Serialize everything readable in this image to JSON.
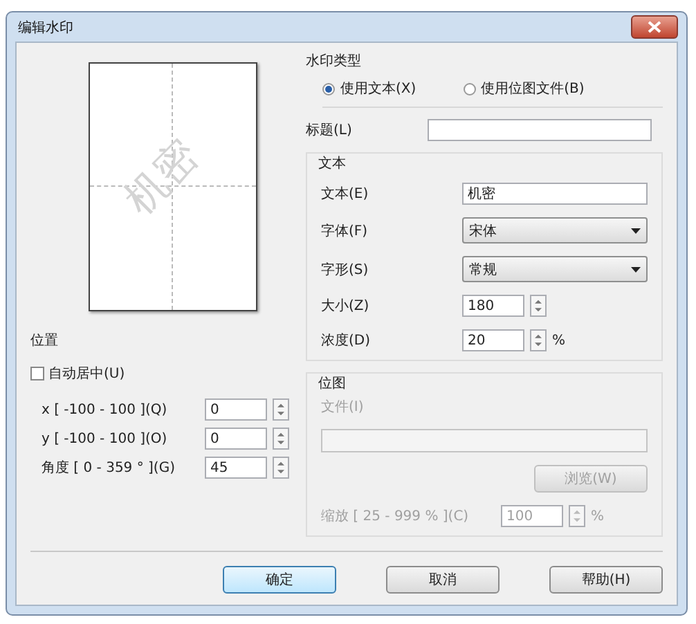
{
  "window": {
    "title": "编辑水印"
  },
  "preview": {
    "text": "机密"
  },
  "position": {
    "label": "位置",
    "auto_center": {
      "label": "自动居中(U)",
      "checked": false
    },
    "fields": [
      {
        "label": "x [ -100 - 100 ](Q)",
        "value": "0"
      },
      {
        "label": "y [ -100 - 100 ](O)",
        "value": "0"
      },
      {
        "label": "角度 [ 0 - 359 ° ](G)",
        "value": "45"
      }
    ]
  },
  "watermark_type": {
    "label": "水印类型",
    "options": [
      {
        "label": "使用文本(X)",
        "selected": true
      },
      {
        "label": "使用位图文件(B)",
        "selected": false
      }
    ]
  },
  "title_field": {
    "label": "标题(L)"
  },
  "text_group": {
    "label": "文本",
    "rows": [
      {
        "kind": "input",
        "label": "文本(E)",
        "value": "机密"
      },
      {
        "kind": "select",
        "label": "字体(F)",
        "value": "宋体"
      },
      {
        "kind": "select",
        "label": "字形(S)",
        "value": "常规"
      },
      {
        "kind": "spin",
        "label": "大小(Z)",
        "value": "180"
      },
      {
        "kind": "spin",
        "label": "浓度(D)",
        "value": "20",
        "unit": "%"
      }
    ]
  },
  "bitmap_group": {
    "label": "位图",
    "disabled": true,
    "file_label": "文件(I)",
    "browse": "浏览(W)",
    "scale": {
      "label": "缩放 [ 25 - 999 % ](C)",
      "value": "100",
      "unit": "%"
    }
  },
  "buttons": [
    {
      "label": "确定",
      "default": true
    },
    {
      "label": "取消",
      "default": false
    },
    {
      "label": "帮助(H)",
      "default": false
    }
  ]
}
